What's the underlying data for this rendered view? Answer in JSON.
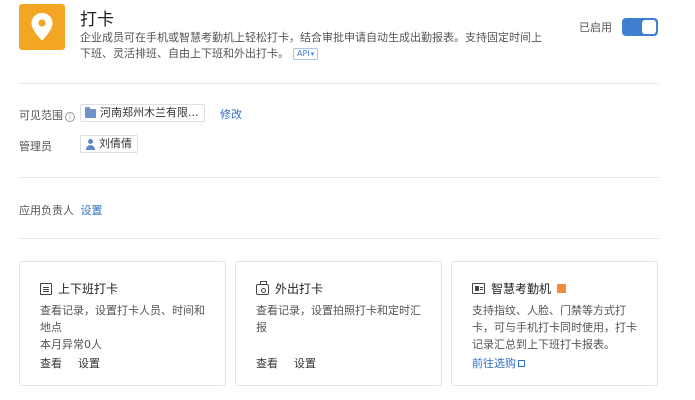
{
  "app": {
    "title": "打卡",
    "description": "企业成员可在手机或智慧考勤机上轻松打卡，结合审批申请自动生成出勤报表。支持固定时间上下班、灵活排班、自由上下班和外出打卡。",
    "api_badge": "API",
    "status_label": "已启用",
    "enabled": true
  },
  "visible_range": {
    "label": "可见范围",
    "value": "河南郑州木兰有限...",
    "edit_label": "修改"
  },
  "admins": {
    "label": "管理员",
    "value": "刘倩倩"
  },
  "owner": {
    "label": "应用负责人",
    "set_label": "设置"
  },
  "cards": [
    {
      "title": "上下班打卡",
      "desc": "查看记录，设置打卡人员、时间和地点",
      "extra": "本月异常0人",
      "actions": [
        "查看",
        "设置"
      ]
    },
    {
      "title": "外出打卡",
      "desc": "查看记录，设置拍照打卡和定时汇报",
      "actions": [
        "查看",
        "设置"
      ]
    },
    {
      "title": "智慧考勤机",
      "desc": "支持指纹、人脸、门禁等方式打卡，可与手机打卡同时使用，打卡记录汇总到上下班打卡报表。",
      "actions": [
        "前往选购"
      ]
    }
  ],
  "colors": {
    "brand": "#f3a524",
    "accent": "#3f7fd1",
    "link": "#2f6fc6",
    "new_badge": "#f08a3c"
  }
}
